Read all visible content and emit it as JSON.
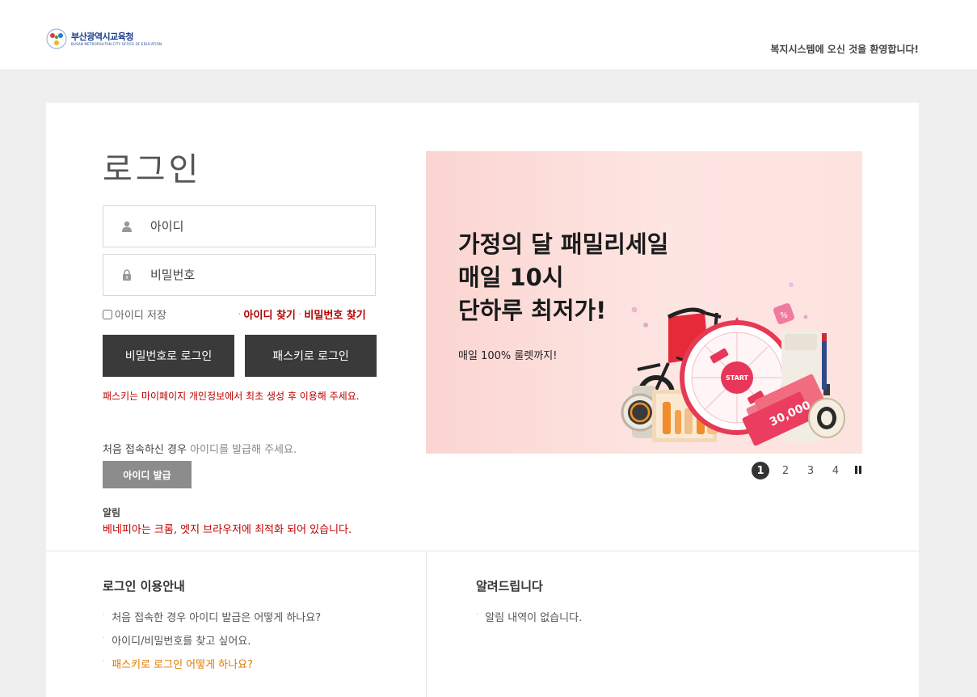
{
  "header": {
    "logo_kr": "부산광역시교육청",
    "logo_en": "BUSAN METROPOLITAN CITY OFFICE OF EDUCATION",
    "welcome": "복지시스템에 오신 것을 환영합니다!"
  },
  "login": {
    "title": "로그인",
    "id_placeholder": "아이디",
    "pw_placeholder": "비밀번호",
    "save_id_label": "아이디 저장",
    "find_id": "아이디 찾기",
    "find_pw": "비밀번호 찾기",
    "btn_password_login": "비밀번호로 로그인",
    "btn_passkey_login": "패스키로 로그인",
    "passkey_note": "패스키는 마이페이지 개인정보에서 최초 생성 후 이용해 주세요.",
    "first_visit_text": "처음 접속하신 경우",
    "first_visit_muted": "아이디를 발급해 주세요.",
    "btn_issue_id": "아이디 발급",
    "notice_label": "알림",
    "notice_text": "베네피아는 크롬, 엣지 브라우저에 최적화 되어 있습니다."
  },
  "banner": {
    "line1": "가정의 달 패밀리세일",
    "line2": "매일 10시",
    "line3": "단하루 최저가!",
    "sub": "매일 100% 룰렛까지!",
    "wheel_start": "START",
    "coupon_value": "30,000",
    "colors": {
      "accent": "#e8365a",
      "bg": "#fbd5d1"
    }
  },
  "pager": {
    "pages": [
      "1",
      "2",
      "3",
      "4"
    ],
    "active_index": 0,
    "pause_icon": "pause-icon"
  },
  "guide": {
    "title": "로그인 이용안내",
    "items": [
      {
        "text": "처음 접속한 경우 아이디 발급은 어떻게 하나요?",
        "highlight": false
      },
      {
        "text": "아이디/비밀번호를 찾고 싶어요.",
        "highlight": false
      },
      {
        "text": "패스키로 로그인 어떻게 하나요?",
        "highlight": true
      }
    ]
  },
  "notify": {
    "title": "알려드립니다",
    "empty": "알림 내역이 없습니다."
  }
}
